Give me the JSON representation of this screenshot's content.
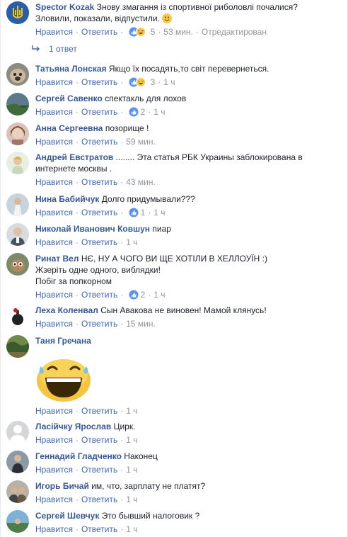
{
  "main": {
    "author": "Spector Kozak",
    "text_line1": "Знову змагання із спортивної риболовлі почалися?",
    "text_line2": "Зловили, показали, відпустили.",
    "like": "Нравится",
    "reply": "Ответить",
    "reactions": "5",
    "time": "53 мин.",
    "edited": "Отредактирован",
    "replies_label": "1 ответ"
  },
  "comments": [
    {
      "author": "Татьяна Лонская",
      "text": "Якщо їх посадять,то світ перевернеться.",
      "like": "Нравится",
      "reply": "Ответить",
      "reactions": "3",
      "time": "1 ч"
    },
    {
      "author": "Сергей Савенко",
      "text": "спектакль для лохов",
      "like": "Нравится",
      "reply": "Ответить",
      "reactions": "2",
      "time": "1 ч"
    },
    {
      "author": "Анна Сергеевна",
      "text": "позорище !",
      "like": "Нравится",
      "reply": "Ответить",
      "time": "59 мин."
    },
    {
      "author": "Андрей Евстратов",
      "text": "........ Эта статья РБК Украины заблокирована в",
      "text2": "интернете москвы .",
      "like": "Нравится",
      "reply": "Ответить",
      "time": "43 мин."
    },
    {
      "author": "Нина Бабийчук",
      "text": "Долго придумывали???",
      "like": "Нравится",
      "reply": "Ответить",
      "reactions": "1",
      "time": "1 ч"
    },
    {
      "author": "Николай Иванович Ковшун",
      "text": "пиар",
      "like": "Нравится",
      "reply": "Ответить",
      "time": "1 ч"
    },
    {
      "author": "Ринат Вел",
      "text": "НЄ, НУ А ЧОГО ВИ ЩЕ ХОТІЛИ В ХЕЛЛОУЇН :)",
      "text2": "Жзеріть одне одного, виблядки!",
      "text3": "Побіг за попкорном",
      "like": "Нравится",
      "reply": "Ответить",
      "reactions": "2",
      "time": "1 ч"
    },
    {
      "author": "Леха Коленвал",
      "text": "Сын Авакова не виновен! Мамой клянусь!",
      "like": "Нравится",
      "reply": "Ответить",
      "time": "15 мин."
    },
    {
      "author": "Таня Гречана",
      "text": "",
      "like": "Нравится",
      "reply": "Ответить",
      "time": "1 ч"
    },
    {
      "author": "Ласійчку Ярослав",
      "text": "Цирк.",
      "like": "Нравится",
      "reply": "Ответить",
      "time": "1 ч"
    },
    {
      "author": "Геннадий Гладченко",
      "text": "Наконец",
      "like": "Нравится",
      "reply": "Ответить",
      "time": "1 ч"
    },
    {
      "author": "Игорь Бичай",
      "text": "им, что, зарплату не платят?",
      "like": "Нравится",
      "reply": "Ответить",
      "time": "1 ч"
    },
    {
      "author": "Сергей Шевчук",
      "text": "Это бывший налоговик ?",
      "like": "Нравится",
      "reply": "Ответить",
      "time": "1 ч"
    }
  ],
  "colors": {
    "link": "#4267b2",
    "author": "#365899",
    "meta": "#90949c",
    "like_blue": "#5890ff"
  },
  "icons": [
    "trident-coat-of-arms-avatar",
    "like-icon",
    "haha-icon",
    "reply-arrow-icon",
    "laughing-sticker"
  ]
}
